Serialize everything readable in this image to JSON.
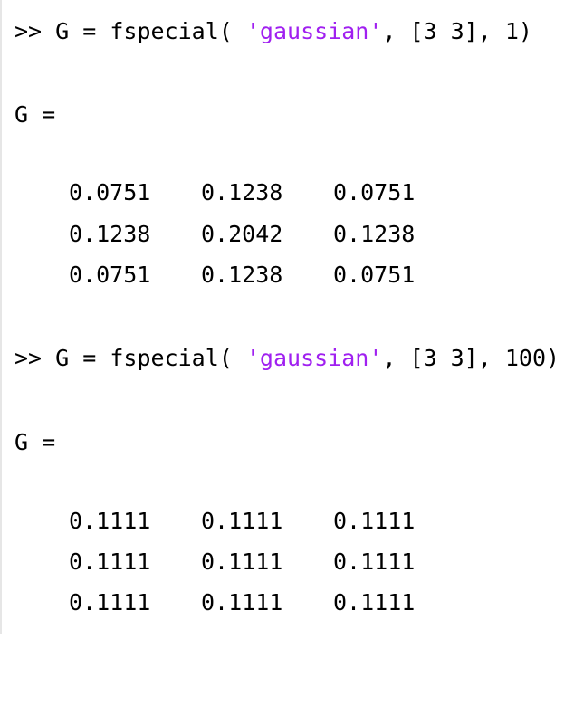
{
  "console": {
    "blocks": [
      {
        "prompt": ">> ",
        "command_pre": "G = fspecial( ",
        "command_str": "'gaussian'",
        "command_post": ", [3 3], 1)",
        "output_header": "G =",
        "matrix": [
          [
            "0.0751",
            "0.1238",
            "0.0751"
          ],
          [
            "0.1238",
            "0.2042",
            "0.1238"
          ],
          [
            "0.0751",
            "0.1238",
            "0.0751"
          ]
        ]
      },
      {
        "prompt": ">> ",
        "command_pre": "G = fspecial( ",
        "command_str": "'gaussian'",
        "command_post": ", [3 3], 100)",
        "output_header": "G =",
        "matrix": [
          [
            "0.1111",
            "0.1111",
            "0.1111"
          ],
          [
            "0.1111",
            "0.1111",
            "0.1111"
          ],
          [
            "0.1111",
            "0.1111",
            "0.1111"
          ]
        ]
      }
    ]
  },
  "colors": {
    "background": "#ffffff",
    "text": "#000000",
    "string_literal": "#a020f0"
  }
}
